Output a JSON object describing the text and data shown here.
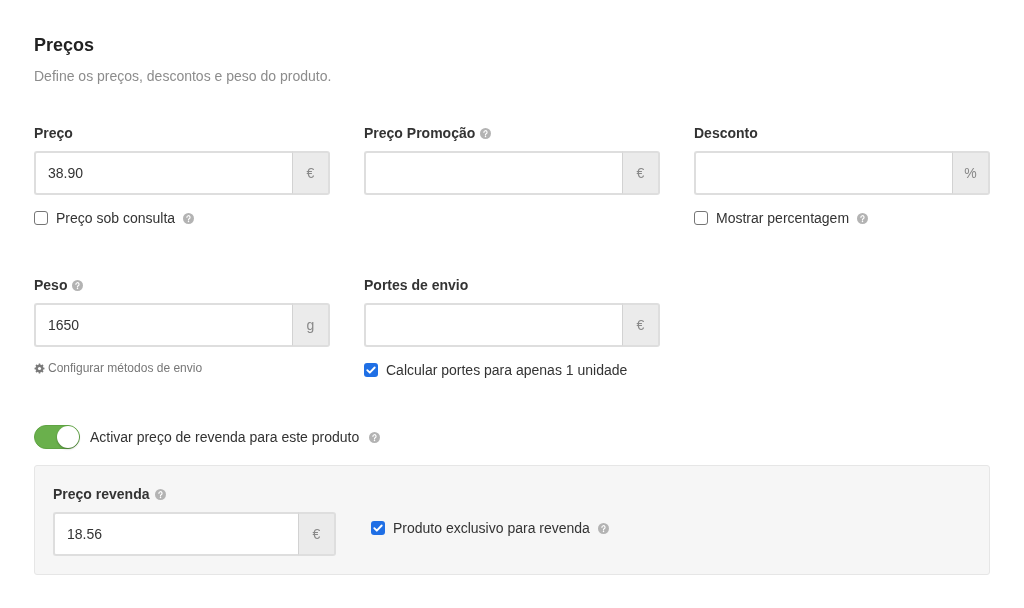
{
  "section": {
    "title": "Preços",
    "description": "Define os preços, descontos e peso do produto."
  },
  "rows": [
    {
      "fields": [
        {
          "label": "Preço",
          "help": false,
          "value": "38.90",
          "unit": "€",
          "option": {
            "kind": "checkbox",
            "label": "Preço sob consulta",
            "checked": false,
            "help": true
          }
        },
        {
          "label": "Preço Promoção",
          "help": true,
          "unit": "€"
        },
        {
          "label": "Desconto",
          "help": false,
          "unit": "%",
          "option": {
            "kind": "checkbox",
            "label": "Mostrar percentagem",
            "checked": false,
            "help": true
          }
        }
      ]
    },
    {
      "fields": [
        {
          "label": "Peso",
          "help": true,
          "value": "1650",
          "unit": "g",
          "option": {
            "kind": "link",
            "label": "Configurar métodos de envio"
          }
        },
        {
          "label": "Portes de envio",
          "help": false,
          "unit": "€",
          "option": {
            "kind": "checkbox",
            "label": "Calcular portes para apenas 1 unidade",
            "checked": true,
            "help": false
          }
        }
      ]
    }
  ],
  "resale_toggle": {
    "label": "Activar preço de revenda para este produto",
    "on": true,
    "help": true
  },
  "resale_panel": {
    "field": {
      "label": "Preço revenda",
      "help": true,
      "value": "18.56",
      "unit": "€"
    },
    "option": {
      "kind": "checkbox",
      "label": "Produto exclusivo para revenda",
      "checked": true,
      "help": true
    }
  }
}
